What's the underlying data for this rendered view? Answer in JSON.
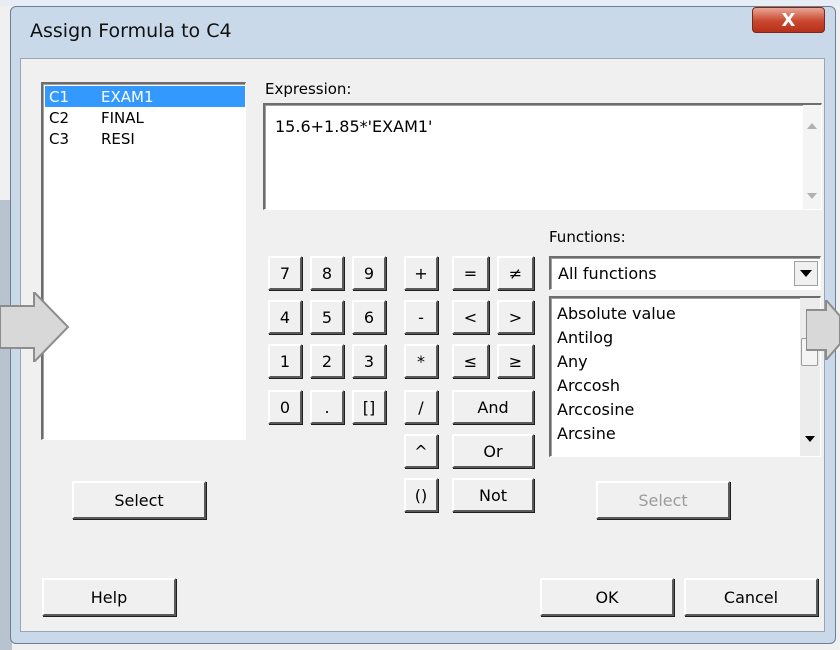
{
  "window": {
    "title": "Assign Formula to C4",
    "close_glyph": "X"
  },
  "columns": [
    {
      "id": "C1",
      "name": "EXAM1",
      "selected": true
    },
    {
      "id": "C2",
      "name": "FINAL",
      "selected": false
    },
    {
      "id": "C3",
      "name": "RESI",
      "selected": false
    }
  ],
  "expression": {
    "label": "Expression:",
    "value": "15.6+1.85*'EXAM1'"
  },
  "keypad": {
    "k7": "7",
    "k8": "8",
    "k9": "9",
    "k4": "4",
    "k5": "5",
    "k6": "6",
    "k1": "1",
    "k2": "2",
    "k3": "3",
    "k0": "0",
    "kdot": ".",
    "kbrackets": "[]",
    "plus": "+",
    "minus": "-",
    "times": "*",
    "divide": "/",
    "power": "^",
    "parens": "()",
    "eq": "=",
    "neq": "≠",
    "lt": "<",
    "gt": ">",
    "le": "≤",
    "ge": "≥",
    "and": "And",
    "or": "Or",
    "not": "Not"
  },
  "functions": {
    "label": "Functions:",
    "selected_category": "All functions",
    "items": [
      "Absolute value",
      "Antilog",
      "Any",
      "Arccosh",
      "Arccosine",
      "Arcsine"
    ]
  },
  "buttons": {
    "select_columns": "Select",
    "select_function": "Select",
    "help": "Help",
    "ok": "OK",
    "cancel": "Cancel"
  }
}
